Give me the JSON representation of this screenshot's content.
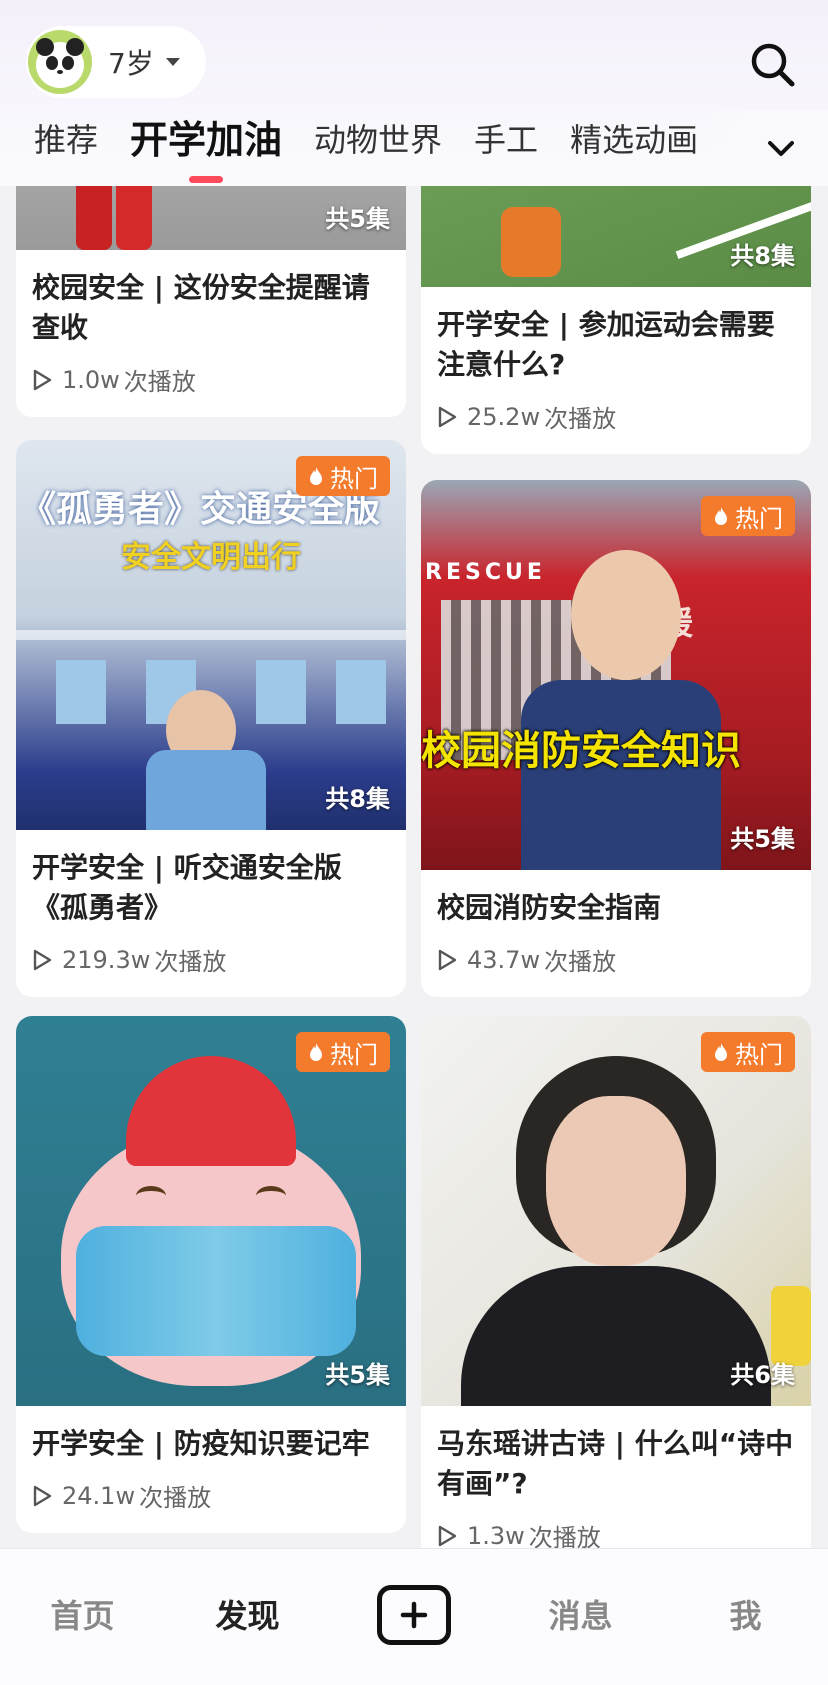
{
  "header": {
    "age_label": "7岁",
    "avatar_icon": "panda-avatar",
    "search_icon": "search-icon"
  },
  "tabs": [
    {
      "label": "推荐",
      "active": false
    },
    {
      "label": "开学加油",
      "active": true
    },
    {
      "label": "动物世界",
      "active": false
    },
    {
      "label": "手工",
      "active": false
    },
    {
      "label": "精选动画",
      "active": false
    }
  ],
  "feed": {
    "play_suffix": "次播放",
    "cards": [
      {
        "title": "校园安全 | 这份安全提醒请查收",
        "episodes": "共5集",
        "plays": "1.0w",
        "hot": false
      },
      {
        "title": "开学安全 | 参加运动会需要注意什么?",
        "episodes": "共8集",
        "plays": "25.2w",
        "hot": false
      },
      {
        "title": "开学安全 | 听交通安全版《孤勇者》",
        "episodes": "共8集",
        "plays": "219.3w",
        "hot": true,
        "thumb_text_1": "《孤勇者》交通安全版",
        "thumb_text_2": "安全文明出行"
      },
      {
        "title": "校园消防安全指南",
        "episodes": "共5集",
        "plays": "43.7w",
        "hot": true,
        "thumb_text_1": "RESCUE",
        "thumb_text_2": "校园消防安全知识",
        "thumb_text_3": "援"
      },
      {
        "title": "开学安全 | 防疫知识要记牢",
        "episodes": "共5集",
        "plays": "24.1w",
        "hot": true
      },
      {
        "title": "马东瑶讲古诗 | 什么叫“诗中有画”?",
        "episodes": "共6集",
        "plays": "1.3w",
        "hot": true
      }
    ],
    "hot_label": "热门"
  },
  "bottom_nav": {
    "home": "首页",
    "discover": "发现",
    "add_icon": "plus-icon",
    "messages": "消息",
    "me": "我"
  },
  "colors": {
    "accent": "#ff4b5c",
    "hot_badge": "#f47a2c"
  }
}
